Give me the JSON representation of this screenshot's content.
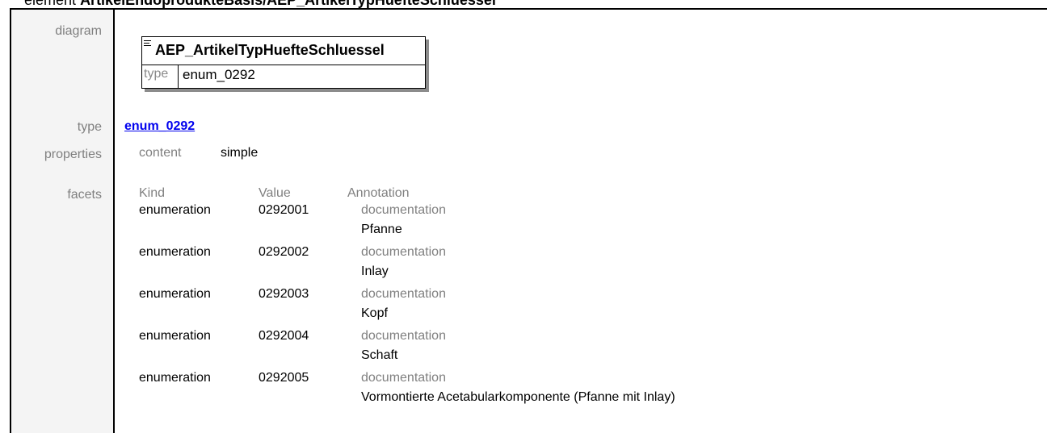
{
  "header": {
    "prefix": "element",
    "name": "ArtikelEndoprodukteBasis/AEP_ArtikelTypHuefteSchluessel"
  },
  "diagram": {
    "label": "diagram",
    "element_name": "AEP_ArtikelTypHuefteSchluessel",
    "type_key": "type",
    "type_value": "enum_0292"
  },
  "type": {
    "label": "type",
    "link": "enum_0292"
  },
  "properties": {
    "label": "properties",
    "key": "content",
    "value": "simple"
  },
  "facets": {
    "label": "facets",
    "headers": [
      "Kind",
      "Value",
      "Annotation"
    ],
    "rows": [
      {
        "kind": "enumeration",
        "value": "0292001",
        "annotation_key": "documentation",
        "annotation_text": "Pfanne"
      },
      {
        "kind": "enumeration",
        "value": "0292002",
        "annotation_key": "documentation",
        "annotation_text": "Inlay"
      },
      {
        "kind": "enumeration",
        "value": "0292003",
        "annotation_key": "documentation",
        "annotation_text": "Kopf"
      },
      {
        "kind": "enumeration",
        "value": "0292004",
        "annotation_key": "documentation",
        "annotation_text": "Schaft"
      },
      {
        "kind": "enumeration",
        "value": "0292005",
        "annotation_key": "documentation",
        "annotation_text": "Vormontierte Acetabularkomponente (Pfanne mit Inlay)"
      }
    ]
  }
}
